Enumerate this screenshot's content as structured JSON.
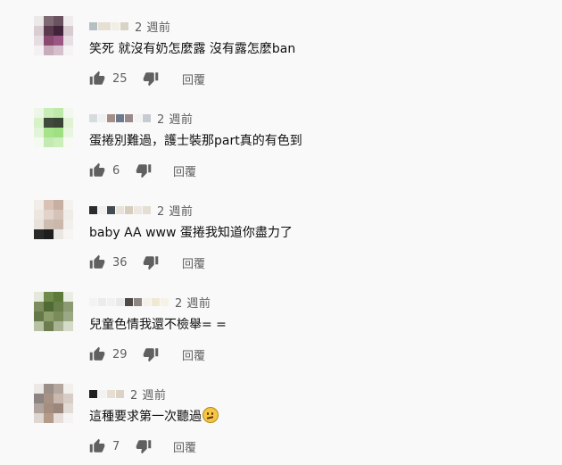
{
  "comments": [
    {
      "time": "2 週前",
      "text": "笑死 就沒有奶怎麼露  沒有露怎麼ban",
      "likes": "25",
      "reply_label": "回覆"
    },
    {
      "time": "2 週前",
      "text": "蛋捲別難過，護士裝那part真的有色到",
      "likes": "6",
      "reply_label": "回覆"
    },
    {
      "time": "2 週前",
      "text": "baby AA www  蛋捲我知道你盡力了",
      "likes": "36",
      "reply_label": "回覆"
    },
    {
      "time": "2 週前",
      "text": "兒童色情我還不檢舉= =",
      "likes": "29",
      "reply_label": "回覆"
    },
    {
      "time": "2 週前",
      "text": "這種要求第一次聽過",
      "likes": "7",
      "reply_label": "回覆",
      "emoji": "thinking-face-emoji"
    }
  ],
  "icons": {
    "like": "thumb-up-icon",
    "dislike": "thumb-down-icon"
  },
  "colors": {
    "icon": "#606060",
    "text": "#0f0f0f",
    "secondary": "#606060",
    "background": "#f9f9f9"
  }
}
